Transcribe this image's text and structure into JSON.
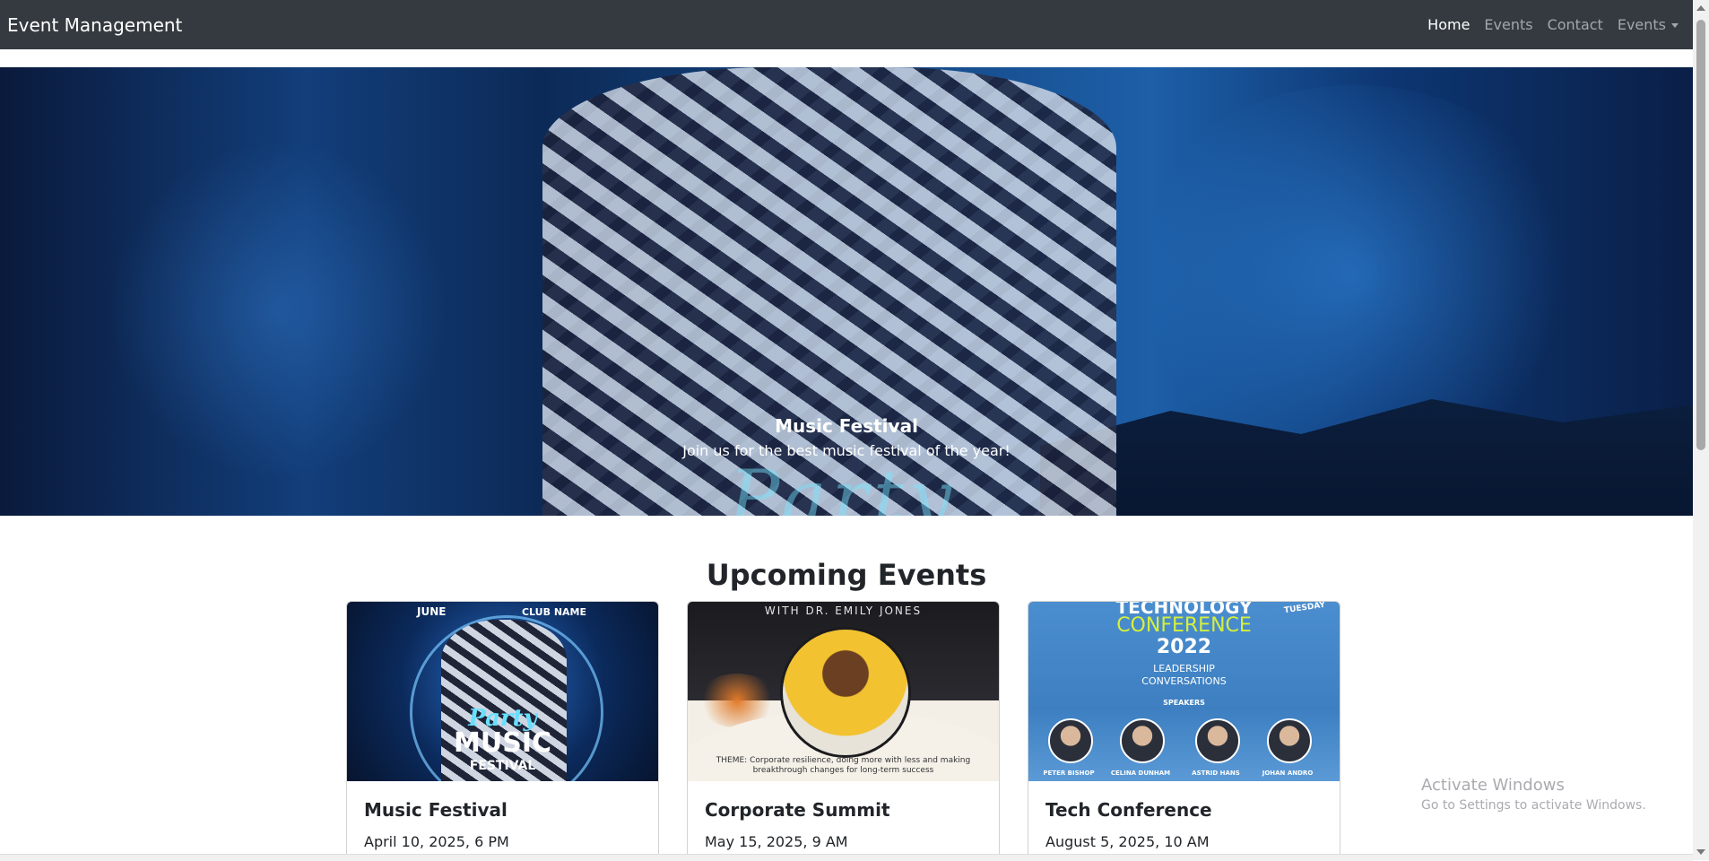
{
  "navbar": {
    "brand": "Event Management",
    "links": [
      {
        "label": "Home",
        "active": true
      },
      {
        "label": "Events",
        "active": false
      },
      {
        "label": "Contact",
        "active": false
      },
      {
        "label": "Events",
        "active": false,
        "dropdown": true
      }
    ]
  },
  "hero": {
    "title": "Music Festival",
    "text": "Join us for the best music festival of the year!"
  },
  "section": {
    "title": "Upcoming Events"
  },
  "cards": [
    {
      "title": "Music Festival",
      "date": "April 10, 2025, 6 PM",
      "image_text": {
        "top_left": "JUNE",
        "top_right": "CLUB NAME",
        "script": "Party",
        "main": "MUSIC",
        "sub": "FESTIVAL"
      }
    },
    {
      "title": "Corporate Summit",
      "date": "May 15, 2025, 9 AM",
      "image_text": {
        "header": "WITH DR. EMILY JONES",
        "theme": "THEME: Corporate resilience, doing more with less and making breakthrough changes for long-term success"
      }
    },
    {
      "title": "Tech Conference",
      "date": "August 5, 2025, 10 AM",
      "image_text": {
        "line1": "TECHNOLOGY",
        "line2": "CONFERENCE",
        "year": "2022",
        "sub1": "LEADERSHIP",
        "sub2": "CONVERSATIONS",
        "speakers_label": "SPEAKERS",
        "badge": "TUESDAY",
        "speakers": [
          "PETER BISHOP",
          "CELINA DUNHAM",
          "ASTRID HANS",
          "JOHAN ANDRO"
        ]
      }
    }
  ],
  "os_overlay": {
    "line1": "Activate Windows",
    "line2": "Go to Settings to activate Windows."
  },
  "colors": {
    "navbar_bg": "#343a40",
    "text": "#212529",
    "link_muted": "rgba(255,255,255,0.55)"
  }
}
